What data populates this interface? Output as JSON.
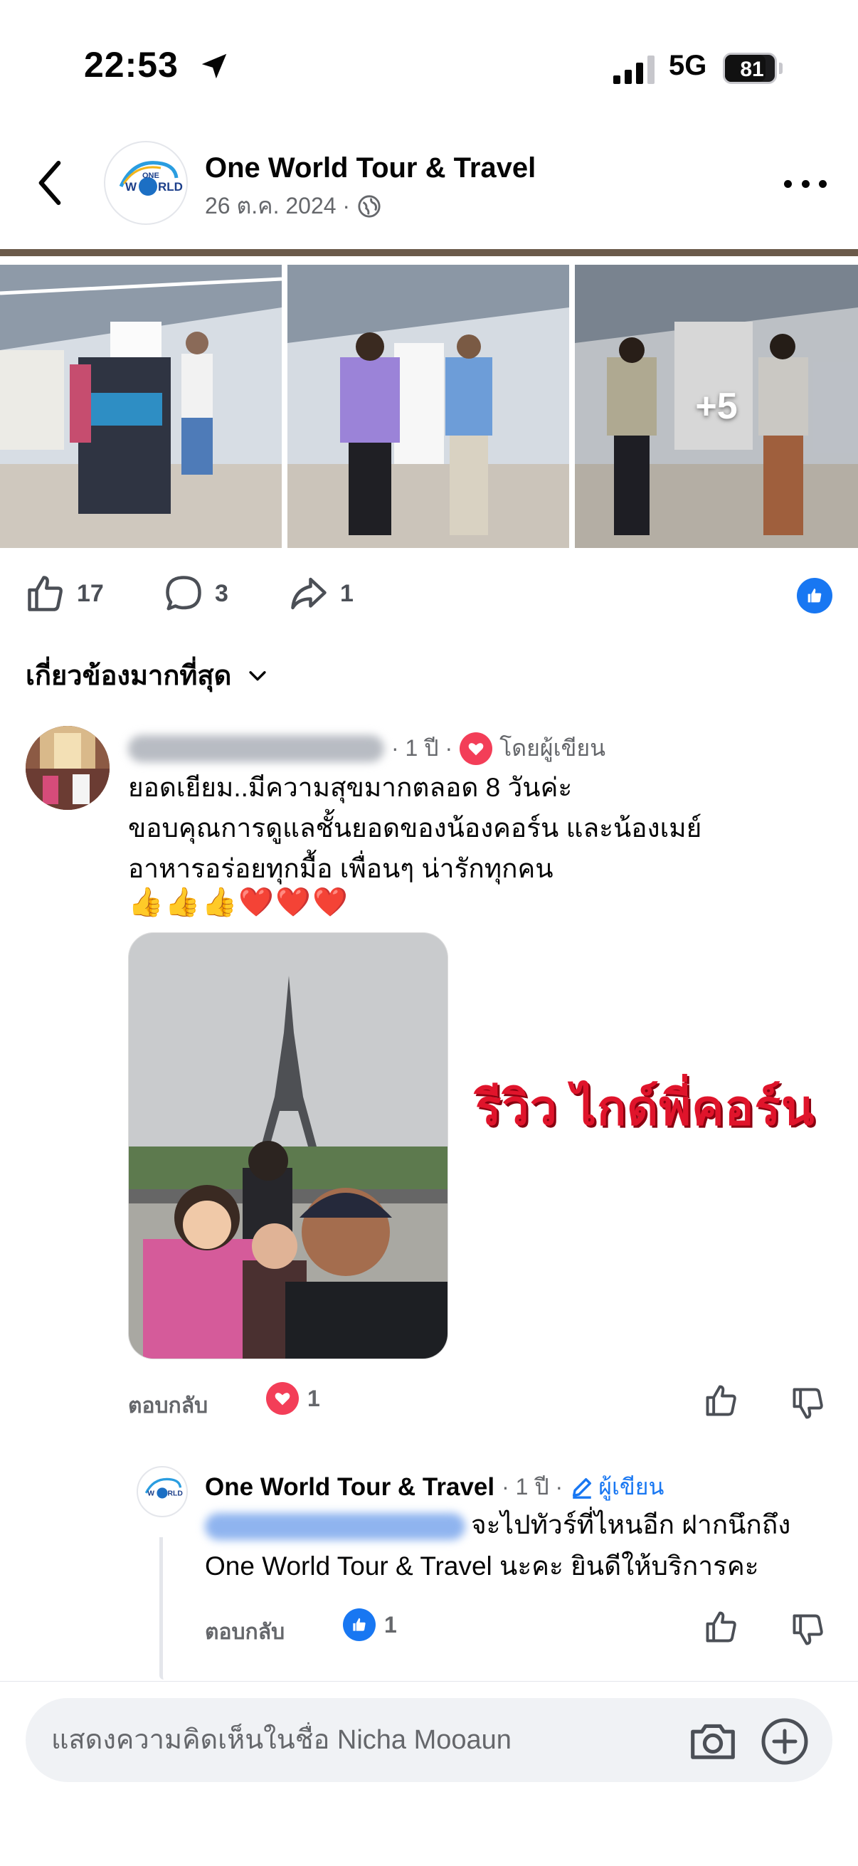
{
  "status_bar": {
    "time": "22:53",
    "network": "5G",
    "battery": "81",
    "battery_level": 0.81
  },
  "header": {
    "page_name": "One World Tour & Travel",
    "date": "26 ต.ค. 2024 ·",
    "privacy_icon": "globe-icon"
  },
  "photos": {
    "more_count": "+5"
  },
  "reactions": {
    "likes": "17",
    "comments": "3",
    "shares": "1"
  },
  "sort": {
    "label": "เกี่ยวข้องมากที่สุด"
  },
  "comment": {
    "time": "· 1 ปี ·",
    "author_reacted": "โดยผู้เขียน",
    "lines": [
      "ยอดเยียม..มีความสุขมากตลอด 8 วันค่ะ",
      "ขอบคุณการดูแลชั้นยอดของน้องคอร์น และน้องเมย์",
      "อาหารอร่อยทุกมื้อ  เพื่อนๆ น่ารักทุกคน"
    ],
    "emoji": "👍👍👍❤️❤️❤️",
    "image_caption": "รีวิว ไกด์พี่คอร์น",
    "reply_label": "ตอบกลับ",
    "reaction_count": "1"
  },
  "reply": {
    "author": "One World Tour & Travel",
    "time": "· 1 ปี ·",
    "author_tag": "ผู้เขียน",
    "text_after_mention": "จะไปทัวร์ที่ไหนอีก ฝากนึกถึง",
    "line2": "One World Tour & Travel นะคะ ยินดีให้บริการคะ",
    "reply_label": "ตอบกลับ",
    "reaction_count": "1"
  },
  "composer": {
    "placeholder": "แสดงความคิดเห็นในชื่อ Nicha Mooaun"
  },
  "colors": {
    "accent": "#1877f2",
    "heart": "#f33e58",
    "review_red": "#e0142b"
  }
}
